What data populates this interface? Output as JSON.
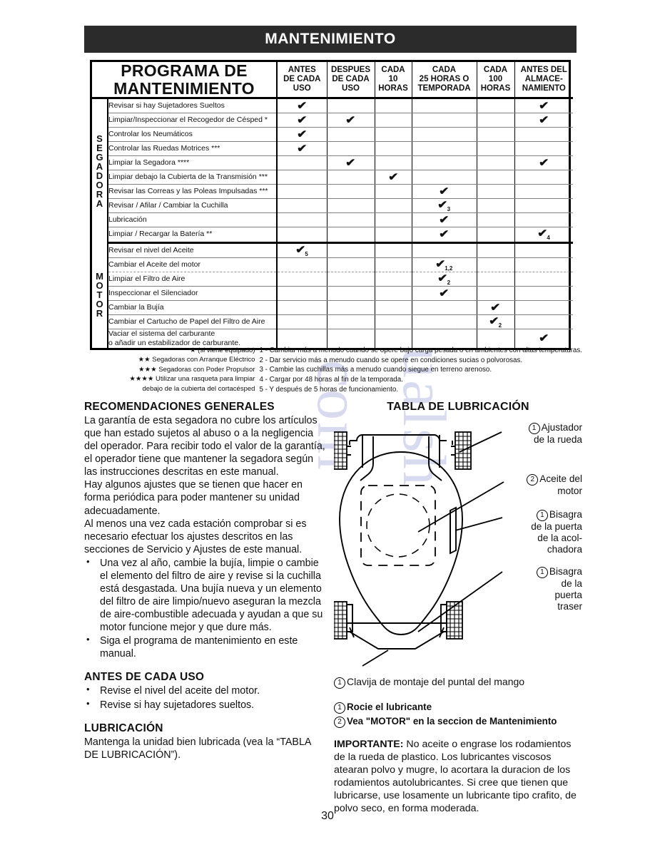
{
  "banner": {
    "title": "MANTENIMIENTO"
  },
  "page": {
    "number": "30"
  },
  "watermark": {
    "line1": "manualsh",
    "line2": "com"
  },
  "schedule": {
    "title": "PROGRAMA DE\nMANTENIMIENTO",
    "title_line1": "PROGRAMA DE",
    "title_line2": "MANTENIMIENTO",
    "columns": [
      "ANTES\nDE CADA\nUSO",
      "DESPUES\nDE CADA\nUSO",
      "CADA\n10\nHORAS",
      "CADA\n25 HORAS O\nTEMPORADA",
      "CADA\n100\nHORAS",
      "ANTES DEL\nALMACE-\nNAMIENTO"
    ],
    "columns_lines": [
      [
        "ANTES",
        "DE CADA",
        "USO"
      ],
      [
        "DESPUES",
        "DE CADA",
        "USO"
      ],
      [
        "CADA",
        "10",
        "HORAS"
      ],
      [
        "CADA",
        "25 HORAS O",
        "TEMPORADA"
      ],
      [
        "CADA",
        "100",
        "HORAS"
      ],
      [
        "ANTES DEL",
        "ALMACE-",
        "NAMIENTO"
      ]
    ],
    "groups": [
      {
        "label": "SEGADORA",
        "rows": [
          {
            "task": "Revisar si hay Sujetadores Sueltos",
            "marks": [
              "✔",
              "",
              "",
              "",
              "",
              "✔"
            ],
            "notes": [
              "",
              "",
              "",
              "",
              "",
              ""
            ]
          },
          {
            "task": "Limpiar/Inspeccionar el Recogedor de Césped *",
            "marks": [
              "✔",
              "✔",
              "",
              "",
              "",
              "✔"
            ],
            "notes": [
              "",
              "",
              "",
              "",
              "",
              ""
            ]
          },
          {
            "task": "Controlar los Neumáticos",
            "marks": [
              "✔",
              "",
              "",
              "",
              "",
              ""
            ],
            "notes": [
              "",
              "",
              "",
              "",
              "",
              ""
            ]
          },
          {
            "task": "Controlar las Ruedas Motrices ***",
            "marks": [
              "✔",
              "",
              "",
              "",
              "",
              ""
            ],
            "notes": [
              "",
              "",
              "",
              "",
              "",
              ""
            ]
          },
          {
            "task": "Limpiar la Segadora ****",
            "marks": [
              "",
              "✔",
              "",
              "",
              "",
              "✔"
            ],
            "notes": [
              "",
              "",
              "",
              "",
              "",
              ""
            ]
          },
          {
            "task": "Limpiar debajo la Cubierta de la Transmisión ***",
            "marks": [
              "",
              "",
              "✔",
              "",
              "",
              ""
            ],
            "notes": [
              "",
              "",
              "",
              "",
              "",
              ""
            ]
          },
          {
            "task": "Revisar las Correas y las Poleas Impulsadas ***",
            "marks": [
              "",
              "",
              "",
              "✔",
              "",
              ""
            ],
            "notes": [
              "",
              "",
              "",
              "",
              "",
              ""
            ]
          },
          {
            "task": "Revisar / Afilar / Cambiar la Cuchilla",
            "marks": [
              "",
              "",
              "",
              "✔",
              "",
              ""
            ],
            "notes": [
              "",
              "",
              "",
              "3",
              "",
              ""
            ]
          },
          {
            "task": "Lubricación",
            "marks": [
              "",
              "",
              "",
              "✔",
              "",
              ""
            ],
            "notes": [
              "",
              "",
              "",
              "",
              "",
              ""
            ]
          },
          {
            "task": "Limpiar / Recargar la Batería **",
            "marks": [
              "",
              "",
              "",
              "✔",
              "",
              "✔"
            ],
            "notes": [
              "",
              "",
              "",
              "",
              "",
              "4"
            ]
          }
        ]
      },
      {
        "label": "MOTOR",
        "rows": [
          {
            "task": "Revisar el nivel del Aceite",
            "marks": [
              "✔",
              "",
              "",
              "",
              "",
              ""
            ],
            "notes": [
              "5",
              "",
              "",
              "",
              "",
              ""
            ]
          },
          {
            "task": "Cambiar el Aceite del motor",
            "marks": [
              "",
              "",
              "",
              "✔",
              "",
              ""
            ],
            "notes": [
              "",
              "",
              "",
              "1,2",
              "",
              ""
            ]
          },
          {
            "task": "Limpiar el Filtro de Aire",
            "marks": [
              "",
              "",
              "",
              "✔",
              "",
              ""
            ],
            "notes": [
              "",
              "",
              "",
              "2",
              "",
              ""
            ]
          },
          {
            "task": "Inspeccionar el Silenciador",
            "marks": [
              "",
              "",
              "",
              "✔",
              "",
              ""
            ],
            "notes": [
              "",
              "",
              "",
              "",
              "",
              ""
            ]
          },
          {
            "task": "Cambiar la Bujía",
            "marks": [
              "",
              "",
              "",
              "",
              "✔",
              ""
            ],
            "notes": [
              "",
              "",
              "",
              "",
              "",
              ""
            ]
          },
          {
            "task": "Cambiar el Cartucho de Papel del Filtro de Aire",
            "marks": [
              "",
              "",
              "",
              "",
              "✔",
              ""
            ],
            "notes": [
              "",
              "",
              "",
              "",
              "2",
              ""
            ]
          },
          {
            "task": "Vaciar el sistema del carburante\no añadir un estabilizador de carburante.",
            "task_line1": "Vaciar el sistema del carburante",
            "task_line2": "o añadir un estabilizador de carburante.",
            "marks": [
              "",
              "",
              "",
              "",
              "",
              "✔"
            ],
            "notes": [
              "",
              "",
              "",
              "",
              "",
              ""
            ]
          }
        ]
      }
    ],
    "footnotes_left": [
      "★ (si viene equipado)",
      "★★ Segadoras con Arranque Eléctrico",
      "★★★ Segadoras con Poder Propulsor",
      "★★★★ Utilizar una rasqueta para limpiar",
      "debajo de la cubierta del cortacésped"
    ],
    "footnotes_right": [
      "1 - Cambiar más a menudo cuando se opere bajo carga pesada o en ambientes con altas temperaturas.",
      "2 - Dar servicio más a menudo cuando se opere en condiciones sucias o polvorosas.",
      "3 - Cambie las cuchillas más a menudo cuando siegue en terreno arenoso.",
      "4 - Cargar por 48 horas al fin de la temporada.",
      "5 - Y después de 5 horas de funcionamiento."
    ]
  },
  "recommendations": {
    "heading": "RECOMENDACIONES GENERALES",
    "paragraphs": [
      "La garantía de esta segadora no cubre los artículos que han estado sujetos al abuso o a la negligencia del operador. Para recibir todo el valor de la garantía, el operador tiene que mantener la segadora según las instrucciones descritas en este manual.",
      "Hay algunos ajustes que se tienen que hacer en forma periódica para poder mantener su unidad adecuadamente.",
      "Al menos una vez cada estación comprobar si es necesario efectuar los ajustes descritos en las secciones de Servicio y Ajustes de este manual."
    ],
    "bullets": [
      "Una vez al año, cambie la bujía, limpie o cambie el elemento del filtro de aire y revise si la cuchilla está desgastada. Una bujía nueva y un elemento del filtro de aire limpio/nuevo aseguran la mezcla de aire-combustible adecuada y ayudan a que su motor funcione mejor y que dure más.",
      "Siga el programa de mantenimiento en este manual."
    ]
  },
  "before_each_use": {
    "heading": "ANTES DE CADA USO",
    "bullets": [
      "Revise el nivel del aceite del motor.",
      "Revise si hay sujetadores sueltos."
    ]
  },
  "lubrication_left": {
    "heading": "LUBRICACIÓN",
    "text": "Mantenga la unidad bien lubricada (vea la “TABLA DE LUBRICACIÓN”)."
  },
  "lubrication_table": {
    "heading": "TABLA DE LUBRICACIÓN",
    "callouts": [
      {
        "num": "1",
        "lines": [
          "Ajustador",
          "de la rueda"
        ]
      },
      {
        "num": "2",
        "lines": [
          "Aceite del",
          "motor"
        ]
      },
      {
        "num": "1",
        "lines": [
          "Bisagra",
          "de la puerta",
          "de la acol-",
          "chadora"
        ]
      },
      {
        "num": "1",
        "lines": [
          "Bisagra",
          "de la",
          "puerta",
          "traser"
        ]
      }
    ],
    "bottom_callout": {
      "num": "1",
      "text": "Clavija de montaje del puntal del mango"
    },
    "legend": [
      {
        "num": "1",
        "text": "Rocie el lubricante"
      },
      {
        "num": "2",
        "text": "Vea \"MOTOR\" en la seccion de Mantenimiento"
      }
    ]
  },
  "important": {
    "label": "IMPORTANTE:",
    "text": " No aceite o engrase los rodamientos de la rueda de plastico. Los lubricantes viscosos atearan polvo y mugre, lo acortara la duracion de los rodamientos autolubricantes. Si cree que tienen que lubricarse, use losamente un lubricante tipo crafito, de polvo seco, en forma moderada."
  }
}
